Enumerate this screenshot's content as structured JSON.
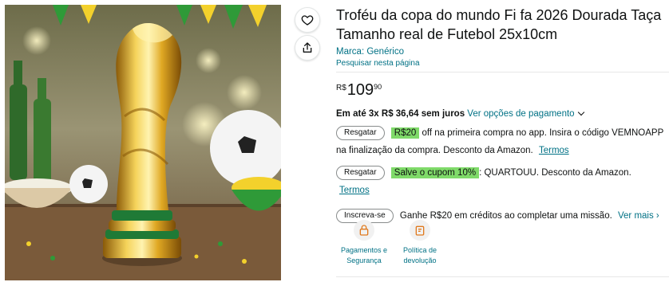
{
  "product": {
    "title": "Troféu da copa do mundo Fi fa 2026 Dourada Taça Tamanho real de Futebol 25x10cm",
    "brand": "Marca: Genérico",
    "search_page": "Pesquisar nesta página"
  },
  "price": {
    "symbol": "R$",
    "whole": "109",
    "fraction": "90"
  },
  "installments": {
    "text": "Em até 3x R$ 36,64 sem juros",
    "link": "Ver opções de pagamento"
  },
  "coupons": [
    {
      "button": "Resgatar",
      "highlight": "R$20",
      "text": "off na primeira compra no app. Insira o código VEMNOAPP na finalização da compra. Desconto da Amazon.",
      "terms": "Termos"
    },
    {
      "button": "Resgatar",
      "highlight": "Salve o cupom 10%",
      "text": ": QUARTOUU. Desconto da Amazon.",
      "terms": "Termos"
    }
  ],
  "mission": {
    "button": "Inscreva-se",
    "text": "Ganhe R$20 em créditos ao completar uma missão.",
    "link": "Ver mais ›"
  },
  "badges": [
    {
      "icon": "payment-security-icon",
      "label": "Pagamentos e Segurança"
    },
    {
      "icon": "return-policy-icon",
      "label": "Política de devolução"
    }
  ],
  "icons": {
    "wishlist": "heart-icon",
    "share": "share-icon"
  },
  "colors": {
    "link": "#007185",
    "highlight": "#7fda69",
    "text": "#0f1111"
  }
}
